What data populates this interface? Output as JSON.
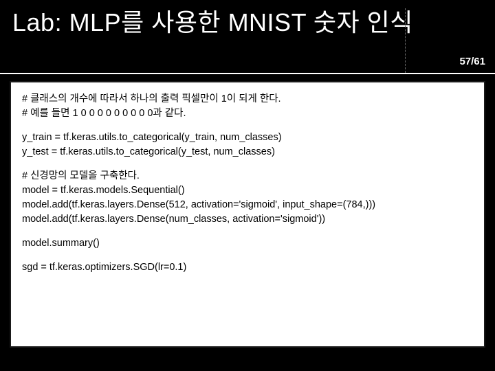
{
  "header": {
    "title": "Lab: MLP를 사용한 MNIST 숫자 인식",
    "page_number": "57/61"
  },
  "code": {
    "b1": "# 클래스의 개수에 따라서 하나의 출력 픽셀만이 1이 되게 한다.\n# 예를 들면 1 0 0 0 0 0 0 0 0 0과 같다.",
    "b2": "y_train = tf.keras.utils.to_categorical(y_train, num_classes)\ny_test = tf.keras.utils.to_categorical(y_test, num_classes)",
    "b3": "# 신경망의 모델을 구축한다.\nmodel = tf.keras.models.Sequential()\nmodel.add(tf.keras.layers.Dense(512, activation='sigmoid', input_shape=(784,)))\nmodel.add(tf.keras.layers.Dense(num_classes, activation='sigmoid'))",
    "b4": "model.summary()",
    "b5": "sgd = tf.keras.optimizers.SGD(lr=0.1)"
  }
}
